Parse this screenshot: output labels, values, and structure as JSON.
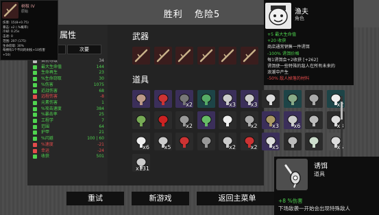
{
  "header": {
    "result": "胜利",
    "danger": "危险5"
  },
  "stats_panel": {
    "title": "属性",
    "tab_secondary": "次要",
    "rows": [
      {
        "label": "目前等级",
        "value": "34",
        "color": "#bbbbbb",
        "icon": "level-icon"
      },
      {
        "label": "最大生命值",
        "value": "144",
        "color": "#4fd44f",
        "icon": "heart-icon"
      },
      {
        "label": "生命再生",
        "value": "23",
        "color": "#4fd44f",
        "icon": "regen-icon"
      },
      {
        "label": "%生命窃取",
        "value": "30",
        "color": "#4fd44f",
        "icon": "lifesteal-icon"
      },
      {
        "label": "%伤害",
        "value": "1075",
        "color": "#4fd44f",
        "icon": "damage-icon"
      },
      {
        "label": "近战伤害",
        "value": "68",
        "color": "#4fd44f",
        "icon": "melee-icon"
      },
      {
        "label": "远程伤害",
        "value": "-8",
        "color": "#e34b4b",
        "icon": "ranged-icon"
      },
      {
        "label": "元素伤害",
        "value": "1",
        "color": "#4fd44f",
        "icon": "elemental-icon"
      },
      {
        "label": "%攻击速度",
        "value": "384",
        "color": "#4fd44f",
        "icon": "attack-speed-icon"
      },
      {
        "label": "%暴击率",
        "value": "25",
        "color": "#4fd44f",
        "icon": "crit-icon"
      },
      {
        "label": "工程学",
        "value": "7",
        "color": "#4fd44f",
        "icon": "engineering-icon"
      },
      {
        "label": "范围",
        "value": "64",
        "color": "#4fd44f",
        "icon": "range-icon"
      },
      {
        "label": "护甲",
        "value": "21",
        "color": "#4fd44f",
        "icon": "armor-icon"
      },
      {
        "label": "%闪避",
        "value": "100 | 60",
        "color": "#4fd44f",
        "icon": "dodge-icon"
      },
      {
        "label": "%速度",
        "value": "-21",
        "color": "#e34b4b",
        "icon": "speed-icon"
      },
      {
        "label": "幸运",
        "value": "-24",
        "color": "#e34b4b",
        "icon": "luck-icon"
      },
      {
        "label": "收获",
        "value": "501",
        "color": "#4fd44f",
        "icon": "harvest-icon"
      }
    ]
  },
  "weapons": {
    "title": "武器",
    "slots": [
      {
        "icon": "branch-weapon-icon"
      },
      {
        "icon": "branch-weapon-icon"
      },
      {
        "icon": "branch-weapon-icon"
      },
      {
        "icon": "branch-weapon-icon"
      },
      {
        "icon": "branch-weapon-icon"
      },
      {
        "icon": "branch-weapon-icon"
      }
    ]
  },
  "items": {
    "title": "道具",
    "slots": [
      {
        "icon": "mushroom-hat-icon",
        "count": "",
        "bg": "#3b2f5a"
      },
      {
        "icon": "red-cape-icon",
        "count": "",
        "bg": "#3b2f5a"
      },
      {
        "icon": "claw-icon",
        "count": "x2",
        "bg": "#3b2f5a"
      },
      {
        "icon": "snail-icon",
        "count": "",
        "bg": "#1d4447"
      },
      {
        "icon": "bell-helmet-icon",
        "count": "x3",
        "bg": "#3b2f5a"
      },
      {
        "icon": "bell-helmet-icon",
        "count": "x3",
        "bg": "#3b2f5a"
      },
      {
        "icon": "fish-bone-icon",
        "count": "",
        "bg": "#2b2b2b"
      },
      {
        "icon": "boot-icon",
        "count": "",
        "bg": "#1d4447"
      },
      {
        "icon": "helmet-icon",
        "count": "",
        "bg": "#2b2b2b"
      },
      {
        "icon": "arrow-icon",
        "count": "x2",
        "bg": "#1d4447"
      },
      {
        "icon": "tree-icon",
        "count": "",
        "bg": "#2b2b2b"
      },
      {
        "icon": "red-gem-icon",
        "count": "",
        "bg": "#2b2b2b"
      },
      {
        "icon": "ufo-icon",
        "count": "x2",
        "bg": "#2b2b2b"
      },
      {
        "icon": "green-brain-icon",
        "count": "",
        "bg": "#3b2f5a"
      },
      {
        "icon": "cup-icon",
        "count": "",
        "bg": "#2b2b2b"
      },
      {
        "icon": "tentacle-icon",
        "count": "x2",
        "bg": "#2b2b2b"
      },
      {
        "icon": "chest-icon",
        "count": "x3",
        "bg": "#3b2f5a"
      },
      {
        "icon": "book-icon",
        "count": "x6",
        "bg": "#3b2f5a"
      },
      {
        "icon": "bomb-icon",
        "count": "",
        "bg": "#2b2b2b"
      },
      {
        "icon": "bowl-icon",
        "count": "x3",
        "bg": "#2b2b2b"
      },
      {
        "icon": "spikes-icon",
        "count": "x6",
        "bg": "#2b2b2b"
      },
      {
        "icon": "worm-icon",
        "count": "x5",
        "bg": "#2b2b2b"
      },
      {
        "icon": "syringe-icon",
        "count": "",
        "bg": "#2b2b2b"
      },
      {
        "icon": "stone-icon",
        "count": "",
        "bg": "#2b2b2b"
      },
      {
        "icon": "sword-icon",
        "count": "x2",
        "bg": "#2b2b2b"
      },
      {
        "icon": "scissors-icon",
        "count": "x2",
        "bg": "#2b2b2b"
      },
      {
        "icon": "scroll-icon",
        "count": "x5",
        "bg": "#3b2f5a"
      },
      {
        "icon": "leaf-icon",
        "count": "",
        "bg": "#2b2b2b"
      },
      {
        "icon": "grass-icon",
        "count": "",
        "bg": "#2b2b2b"
      },
      {
        "icon": "bait-icon",
        "count": "x5",
        "bg": "#4e4e4e"
      },
      {
        "icon": "bait-icon",
        "count": "x131",
        "bg": "#2b2b2b"
      }
    ]
  },
  "buttons": {
    "retry": "重试",
    "new_game": "新游戏",
    "main_menu": "返回主菜单"
  },
  "character_tooltip": {
    "name": "渔夫",
    "type": "角色",
    "lines": [
      {
        "text": "+5 最大生命值",
        "color": "#4fd44f"
      },
      {
        "text": "+20 收获",
        "color": "#4fd44f"
      },
      {
        "text": "商店通常销售一件诱饵",
        "color": "#dddddd"
      },
      {
        "text": "-100% 诱饵价格",
        "color": "#4fd44f"
      },
      {
        "text": "每1诱饵会+2收获 [+262]",
        "color": "#dddddd"
      },
      {
        "text": "诱饵使一些特殊的敌人在所有未来的",
        "color": "#dddddd"
      },
      {
        "text": "浪潮中产生",
        "color": "#dddddd"
      },
      {
        "text": "-50% 敌人掉落的材料",
        "color": "#e34b4b"
      }
    ]
  },
  "weapon_tooltip": {
    "name": "树枝 IV",
    "type": "原始",
    "lines": [
      "伤害: 15(8+0.75)",
      "暴击: x2 (.%概率)",
      "冷却: 0.25s",
      "击退: 0",
      "范围: 207 (175)",
      "生命窃取: 30%",
      "每拥有1个不同的树枝+10伤害",
      "+50)"
    ]
  },
  "item_tooltip": {
    "name": "诱饵",
    "type": "道具",
    "stat": "+8 %伤害",
    "description": "下场敌袭一开始会出现特殊敌人"
  }
}
